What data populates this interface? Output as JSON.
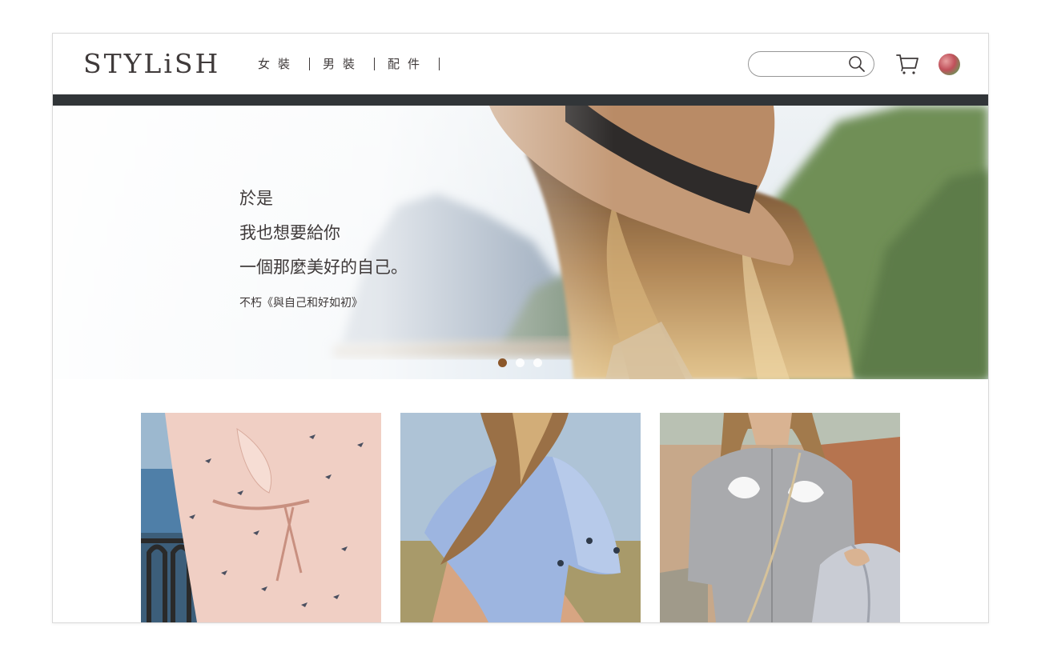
{
  "header": {
    "logo": "STYLiSH",
    "nav": [
      {
        "label": "女裝"
      },
      {
        "label": "男裝"
      },
      {
        "label": "配件"
      }
    ],
    "search": {
      "value": "",
      "placeholder": ""
    },
    "icons": {
      "search": "search-icon",
      "cart": "cart-icon",
      "member": "avatar"
    }
  },
  "hero": {
    "lines": [
      "於是",
      "我也想要給你",
      "一個那麼美好的自己。"
    ],
    "source": "不朽《與自己和好如初》",
    "carousel": {
      "count": 3,
      "active": 0
    }
  },
  "products": [
    {
      "name": "product-card-pink-dress"
    },
    {
      "name": "product-card-blue-top"
    },
    {
      "name": "product-card-gray-shirt"
    }
  ],
  "colors": {
    "text": "#3f3a3a",
    "header_bar": "#313538",
    "dot_active": "#8b572a",
    "border": "#979797"
  }
}
